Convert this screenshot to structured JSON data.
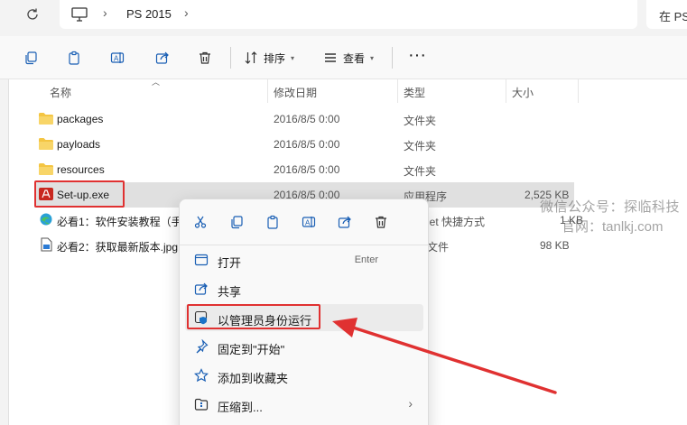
{
  "address": {
    "breadcrumb": "PS 2015",
    "search_placeholder": "在 PS"
  },
  "toolbar": {
    "sort_label": "排序",
    "view_label": "查看",
    "more_label": "···"
  },
  "columns": {
    "name": "名称",
    "modified": "修改日期",
    "type": "类型",
    "size": "大小"
  },
  "files": [
    {
      "name": "packages",
      "modified": "2016/8/5 0:00",
      "type": "文件夹",
      "size": "",
      "icon": "folder-icon"
    },
    {
      "name": "payloads",
      "modified": "2016/8/5 0:00",
      "type": "文件夹",
      "size": "",
      "icon": "folder-icon"
    },
    {
      "name": "resources",
      "modified": "2016/8/5 0:00",
      "type": "文件夹",
      "size": "",
      "icon": "folder-icon"
    },
    {
      "name": "Set-up.exe",
      "modified": "2016/8/5 0:00",
      "type": "应用程序",
      "size": "2,525 KB",
      "icon": "adobe-exe-icon"
    },
    {
      "name": "必看1：软件安装教程（手",
      "modified": "",
      "type": "rnet 快捷方式",
      "size": "1 KB",
      "icon": "edge-shortcut-icon"
    },
    {
      "name": "必看2：获取最新版本.jpg",
      "modified": "",
      "type": "文件",
      "size": "98 KB",
      "icon": "image-file-icon"
    }
  ],
  "context_menu": {
    "icons": [
      "cut-icon",
      "copy-icon",
      "paste-icon",
      "rename-icon",
      "share-icon",
      "delete-icon"
    ],
    "items": [
      {
        "label": "打开",
        "shortcut": "Enter",
        "icon": "open-icon"
      },
      {
        "label": "共享",
        "shortcut": "",
        "icon": "share-icon"
      },
      {
        "label": "以管理员身份运行",
        "shortcut": "",
        "icon": "admin-shield-icon"
      },
      {
        "label": "固定到\"开始\"",
        "shortcut": "",
        "icon": "pin-icon"
      },
      {
        "label": "添加到收藏夹",
        "shortcut": "",
        "icon": "star-icon"
      },
      {
        "label": "压缩到...",
        "shortcut": "",
        "icon": "compress-icon"
      }
    ]
  },
  "watermark": {
    "line1": "微信公众号：探临科技",
    "line2": "官网：tanlkj.com"
  },
  "colors": {
    "highlight_red": "#e03131",
    "folder_yellow": "#f4c542",
    "accent_blue": "#1a73c8"
  }
}
